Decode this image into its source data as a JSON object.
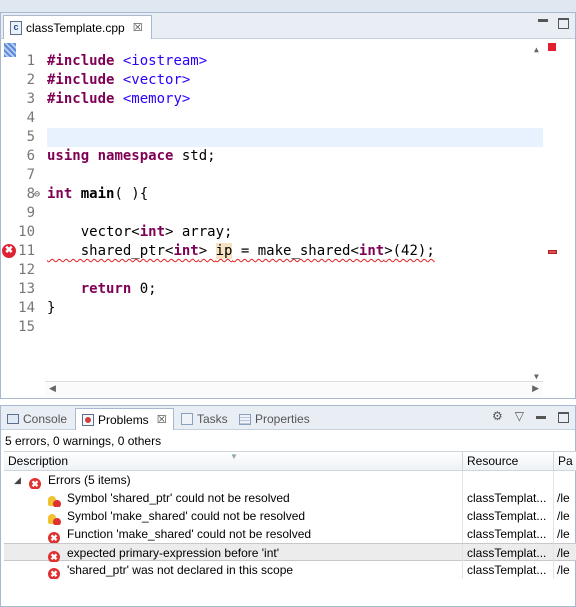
{
  "editor": {
    "tab_label": "classTemplate.cpp",
    "tab_close": "☒",
    "lines": [
      {
        "n": "1",
        "tokens": [
          [
            "kw",
            "#include"
          ],
          [
            "txt",
            " "
          ],
          [
            "inc",
            "<iostream>"
          ]
        ]
      },
      {
        "n": "2",
        "tokens": [
          [
            "kw",
            "#include"
          ],
          [
            "txt",
            " "
          ],
          [
            "inc",
            "<vector>"
          ]
        ]
      },
      {
        "n": "3",
        "tokens": [
          [
            "kw",
            "#include"
          ],
          [
            "txt",
            " "
          ],
          [
            "inc",
            "<memory>"
          ]
        ]
      },
      {
        "n": "4",
        "tokens": []
      },
      {
        "n": "5",
        "tokens": []
      },
      {
        "n": "6",
        "tokens": [
          [
            "kw",
            "using"
          ],
          [
            "txt",
            " "
          ],
          [
            "kw",
            "namespace"
          ],
          [
            "txt",
            " std;"
          ]
        ]
      },
      {
        "n": "7",
        "tokens": []
      },
      {
        "n": "8",
        "tokens": [
          [
            "kw",
            "int"
          ],
          [
            "txt",
            " "
          ],
          [
            "b",
            "main"
          ],
          [
            "txt",
            "( ){"
          ]
        ]
      },
      {
        "n": "9",
        "tokens": []
      },
      {
        "n": "10",
        "tokens": [
          [
            "txt",
            "    vector<"
          ],
          [
            "kw",
            "int"
          ],
          [
            "txt",
            "> array;"
          ]
        ]
      },
      {
        "n": "11",
        "tokens": [
          [
            "sq",
            "    shared_ptr<"
          ],
          [
            "sqkw",
            "int"
          ],
          [
            "sq",
            "> "
          ],
          [
            "occ",
            "ip"
          ],
          [
            "sq",
            " = make_shared<"
          ],
          [
            "sqkw",
            "int"
          ],
          [
            "sq",
            ">(42);"
          ]
        ]
      },
      {
        "n": "12",
        "tokens": []
      },
      {
        "n": "13",
        "tokens": [
          [
            "txt",
            "    "
          ],
          [
            "kw",
            "return"
          ],
          [
            "txt",
            " 0;"
          ]
        ]
      },
      {
        "n": "14",
        "tokens": [
          [
            "txt",
            "}"
          ]
        ]
      },
      {
        "n": "15",
        "tokens": []
      }
    ]
  },
  "problems_view": {
    "tabs": [
      {
        "label": "Console",
        "active": false
      },
      {
        "label": "Problems",
        "active": true
      },
      {
        "label": "Tasks",
        "active": false
      },
      {
        "label": "Properties",
        "active": false
      }
    ],
    "summary": "5 errors, 0 warnings, 0 others",
    "columns": {
      "description": "Description",
      "resource": "Resource",
      "path": "Pa"
    },
    "group_label": "Errors (5 items)",
    "rows": [
      {
        "icon": "error-quickfix-icon",
        "description": "Symbol 'shared_ptr' could not be resolved",
        "resource": "classTemplat...",
        "path": "/le"
      },
      {
        "icon": "error-quickfix-icon",
        "description": "Symbol 'make_shared' could not be resolved",
        "resource": "classTemplat...",
        "path": "/le"
      },
      {
        "icon": "error-icon",
        "description": "Function 'make_shared' could not be resolved",
        "resource": "classTemplat...",
        "path": "/le"
      },
      {
        "icon": "error-icon",
        "description": "expected primary-expression before 'int'",
        "resource": "classTemplat...",
        "path": "/le"
      },
      {
        "icon": "error-icon",
        "description": "'shared_ptr' was not declared in this scope",
        "resource": "classTemplat...",
        "path": "/le"
      }
    ]
  }
}
